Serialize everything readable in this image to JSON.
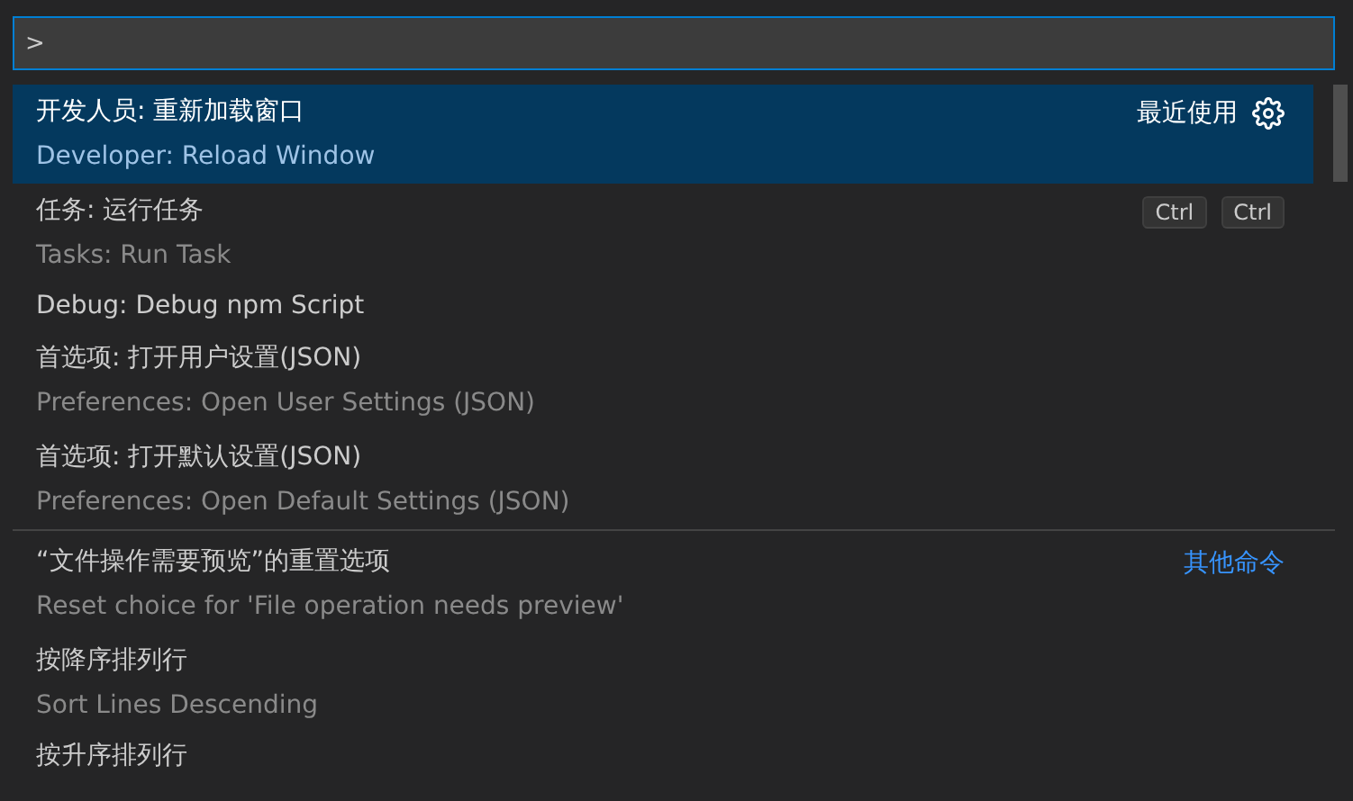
{
  "input": {
    "value": ">"
  },
  "groups": [
    {
      "label": "最近使用",
      "items": [
        {
          "label": "开发人员: 重新加载窗口",
          "description": "Developer: Reload Window",
          "selected": true
        },
        {
          "label": "任务: 运行任务",
          "description": "Tasks: Run Task",
          "selected": false,
          "keys": [
            "Ctrl",
            "Ctrl"
          ]
        },
        {
          "label": "Debug: Debug npm Script",
          "selected": false
        },
        {
          "label": "首选项: 打开用户设置(JSON)",
          "description": "Preferences: Open User Settings (JSON)",
          "selected": false
        },
        {
          "label": "首选项: 打开默认设置(JSON)",
          "description": "Preferences: Open Default Settings (JSON)",
          "selected": false
        }
      ]
    },
    {
      "label": "其他命令",
      "items": [
        {
          "label": "“文件操作需要预览”的重置选项",
          "description": "Reset choice for 'File operation needs preview'",
          "selected": false
        },
        {
          "label": "按降序排列行",
          "description": "Sort Lines Descending",
          "selected": false
        },
        {
          "label": "按升序排列行",
          "selected": false
        }
      ]
    }
  ]
}
